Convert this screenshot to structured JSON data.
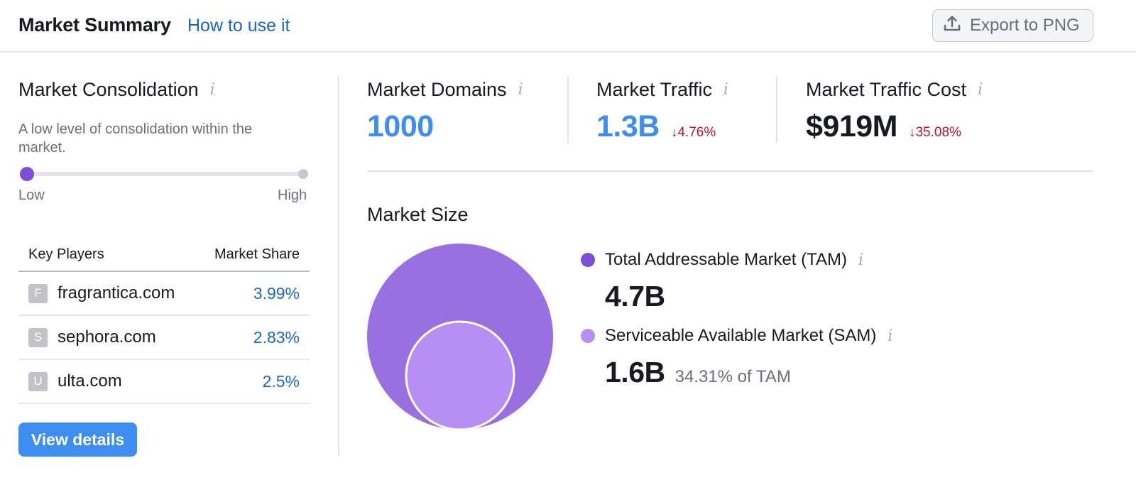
{
  "header": {
    "title": "Market Summary",
    "how_to_link": "How to use it",
    "export_button": "Export to PNG",
    "export_icon": "upload-icon"
  },
  "consolidation": {
    "title": "Market Consolidation",
    "info_icon": "info-icon",
    "description": "A low level of consolidation within the market.",
    "level": 0.0,
    "low_label": "Low",
    "high_label": "High",
    "accent_color": "#7d4fd9"
  },
  "key_players": {
    "col_player": "Key Players",
    "col_share": "Market Share",
    "rows": [
      {
        "letter": "F",
        "domain": "fragrantica.com",
        "share": "3.99%"
      },
      {
        "letter": "S",
        "domain": "sephora.com",
        "share": "2.83%"
      },
      {
        "letter": "U",
        "domain": "ulta.com",
        "share": "2.5%"
      }
    ]
  },
  "view_details_button": "View details",
  "metrics": {
    "domains": {
      "label": "Market Domains",
      "value": "1000"
    },
    "traffic": {
      "label": "Market Traffic",
      "value": "1.3B",
      "delta": "↓4.76%"
    },
    "traffic_cost": {
      "label": "Market Traffic Cost",
      "value": "$919M",
      "delta": "↓35.08%"
    }
  },
  "market_size": {
    "title": "Market Size",
    "tam": {
      "label": "Total Addressable Market (TAM)",
      "value": "4.7B",
      "color": "#7d4fd9",
      "circle_color": "#9870e0"
    },
    "sam": {
      "label": "Serviceable Available Market (SAM)",
      "value": "1.6B",
      "share_of_tam": "34.31% of TAM",
      "color": "#b78ef2"
    }
  },
  "colors": {
    "link": "#1a66c7",
    "primary_button": "#3d8ef0",
    "negative": "#c8102e"
  }
}
